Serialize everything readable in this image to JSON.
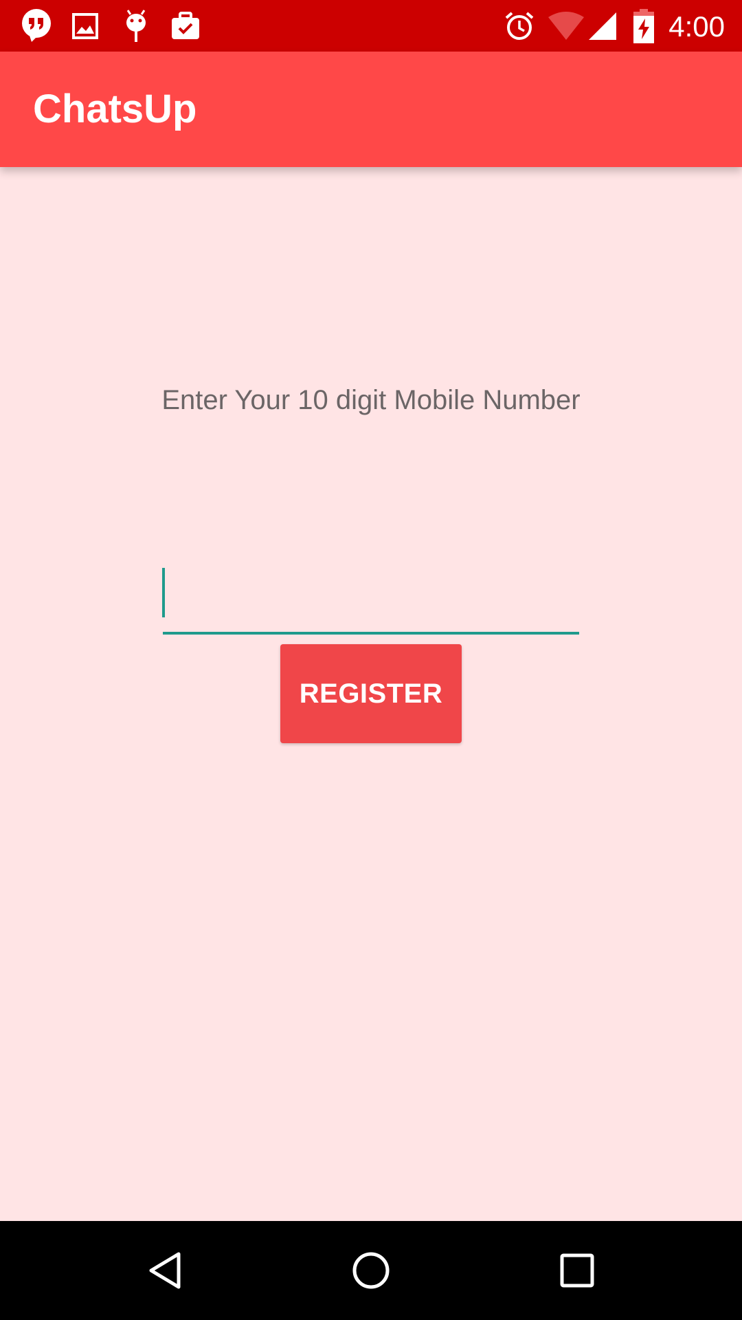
{
  "status_bar": {
    "time": "4:00",
    "left_icons": [
      "hangouts-icon",
      "image-icon",
      "android-debug-icon",
      "briefcase-check-icon"
    ],
    "right_icons": [
      "alarm-icon",
      "wifi-icon",
      "signal-icon",
      "battery-charging-icon"
    ]
  },
  "app_bar": {
    "title": "ChatsUp"
  },
  "main": {
    "prompt": "Enter Your 10 digit Mobile Number",
    "phone_input": {
      "value": "",
      "placeholder": ""
    },
    "register_label": "REGISTER"
  },
  "nav_bar": {
    "buttons": [
      "back-icon",
      "home-icon",
      "recents-icon"
    ]
  },
  "colors": {
    "status_bar": "#CC0000",
    "app_bar": "#FF4848",
    "background": "#FFE4E5",
    "accent": "#1F9A8C",
    "button": "#F04649"
  }
}
